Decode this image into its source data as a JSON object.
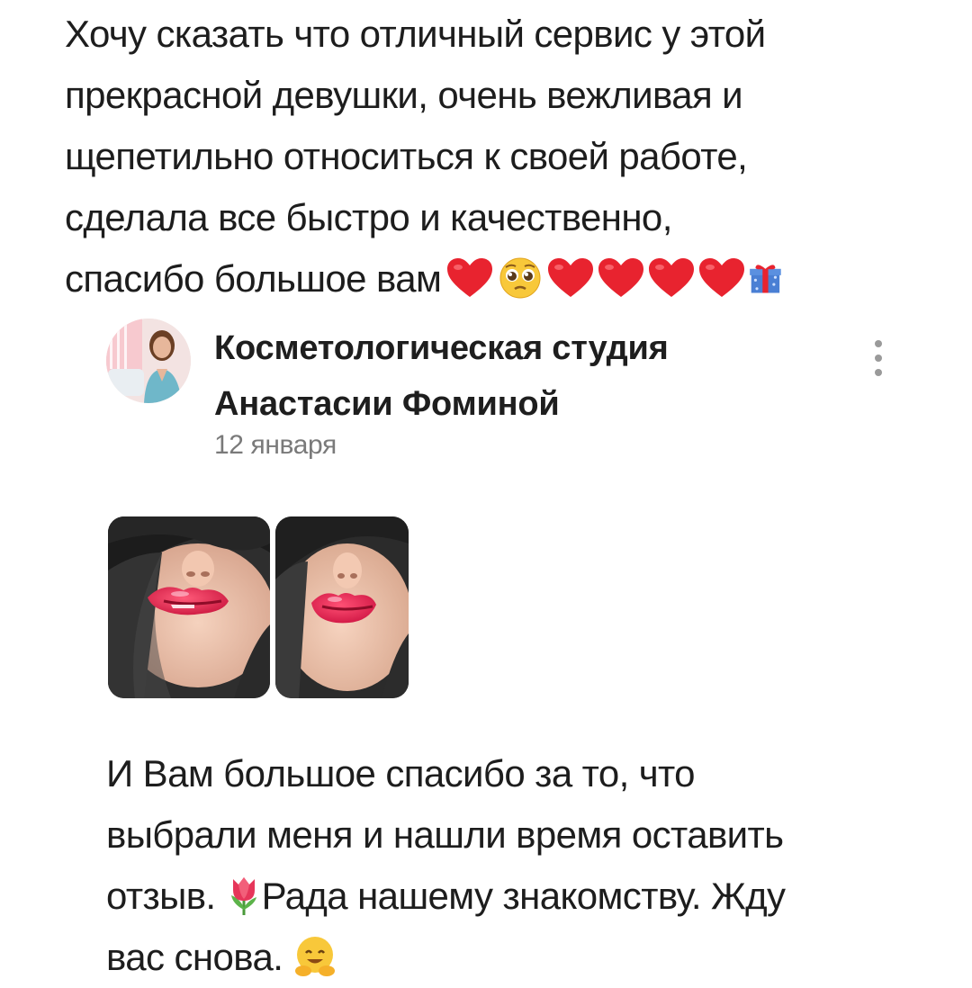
{
  "review": {
    "lines": [
      "Хочу сказать что отличный сервис у этой",
      "прекрасной девушки, очень вежливая и",
      "щепетильно относиться к своей работе,",
      "сделала все быстро и качественно,",
      "спасибо большое вам"
    ],
    "emojis": [
      "red-heart",
      "pleading-face",
      "red-heart",
      "red-heart",
      "red-heart",
      "red-heart",
      "wrapped-gift"
    ]
  },
  "reply": {
    "author_line1": "Косметологическая студия",
    "author_line2": "Анастасии Фоминой",
    "date": "12 января",
    "photos": [
      "lips-photo-1",
      "lips-photo-2"
    ],
    "text_line1": "И Вам большое спасибо за то, что",
    "text_line2": "выбрали меня и нашли время оставить",
    "text_line3_a": "отзыв.",
    "text_line3_b": "Рада нашему знакомству. Жду",
    "text_line4": "вас снова.",
    "icons": [
      "tulip",
      "hugging-face"
    ]
  },
  "colors": {
    "text": "#1d1d1d",
    "secondary_text": "#7a7a7a",
    "heart": "#e8232f"
  }
}
